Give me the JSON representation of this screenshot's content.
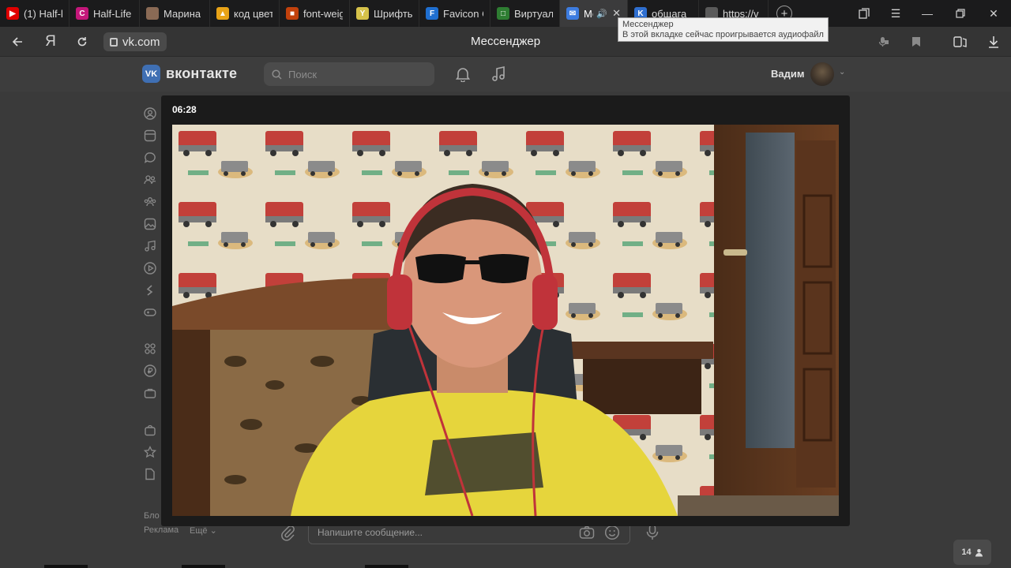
{
  "browser": {
    "tabs": [
      {
        "label": "(1) Half-l",
        "favicon": "youtube-icon",
        "color": "#e00000",
        "glyph": "▶"
      },
      {
        "label": "Half-Life",
        "favicon": "c-letter-icon",
        "color": "#c4177a",
        "glyph": "C"
      },
      {
        "label": "Марина",
        "favicon": "photo-icon",
        "color": "#8a6a55",
        "glyph": ""
      },
      {
        "label": "код цвет",
        "favicon": "image-icon",
        "color": "#e8a317",
        "glyph": "▲"
      },
      {
        "label": "font-weig",
        "favicon": "stack-icon",
        "color": "#c2410c",
        "glyph": "■"
      },
      {
        "label": "Шрифты",
        "favicon": "y-letter-icon",
        "color": "#d6c24a",
        "glyph": "Y"
      },
      {
        "label": "Favicon C",
        "favicon": "f-letter-icon",
        "color": "#1f6fd1",
        "glyph": "F"
      },
      {
        "label": "Виртуал",
        "favicon": "green-square-icon",
        "color": "#2e7d32",
        "glyph": "□"
      },
      {
        "label": "Ме",
        "favicon": "messenger-icon",
        "color": "#3d7ce0",
        "glyph": "✉",
        "active": true
      },
      {
        "label": "общага",
        "favicon": "vk-icon",
        "color": "#2f6fd0",
        "glyph": "K"
      },
      {
        "label": "https://v",
        "favicon": "page-icon",
        "color": "#5a5a5a",
        "glyph": ""
      }
    ],
    "url": "vk.com",
    "page_title": "Мессенджер",
    "tooltip": {
      "title": "Мессенджер",
      "subtitle": "В этой вкладке сейчас проигрывается аудиофайл"
    }
  },
  "vk": {
    "logo_text": "вконтакте",
    "search_placeholder": "Поиск",
    "user_name": "Вадим",
    "footer": {
      "blog": "Бло",
      "ads": "Реклама",
      "more": "Ещё"
    },
    "composer_placeholder": "Напишите сообщение...",
    "participants_count": "14"
  },
  "call": {
    "timer": "06:28"
  },
  "colors": {
    "accent": "#3f6fb3",
    "page_bg": "#3a3a3a",
    "overlay_bg": "#1b1b1b"
  }
}
